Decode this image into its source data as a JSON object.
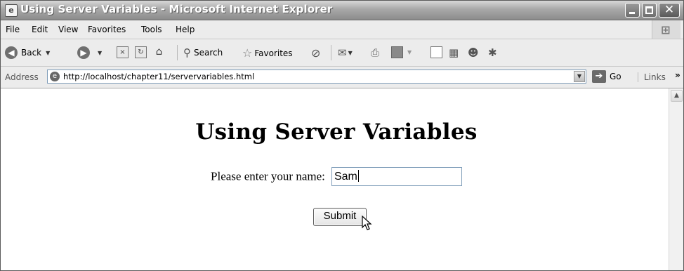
{
  "window": {
    "title": "Using Server Variables - Microsoft Internet Explorer",
    "icon": "ie-page-icon",
    "controls": {
      "minimize": "minimize-icon",
      "maximize": "maximize-icon",
      "close": "✕"
    }
  },
  "menubar": {
    "items": [
      "File",
      "Edit",
      "View",
      "Favorites",
      "Tools",
      "Help"
    ]
  },
  "toolbar": {
    "back_label": "Back",
    "search_label": "Search",
    "favorites_label": "Favorites"
  },
  "address": {
    "label": "Address",
    "url": "http://localhost/chapter11/servervariables.html",
    "go_label": "Go",
    "links_label": "Links"
  },
  "page": {
    "heading": "Using Server Variables",
    "name_label": "Please enter your name:",
    "name_value": "Sam",
    "submit_label": "Submit"
  }
}
